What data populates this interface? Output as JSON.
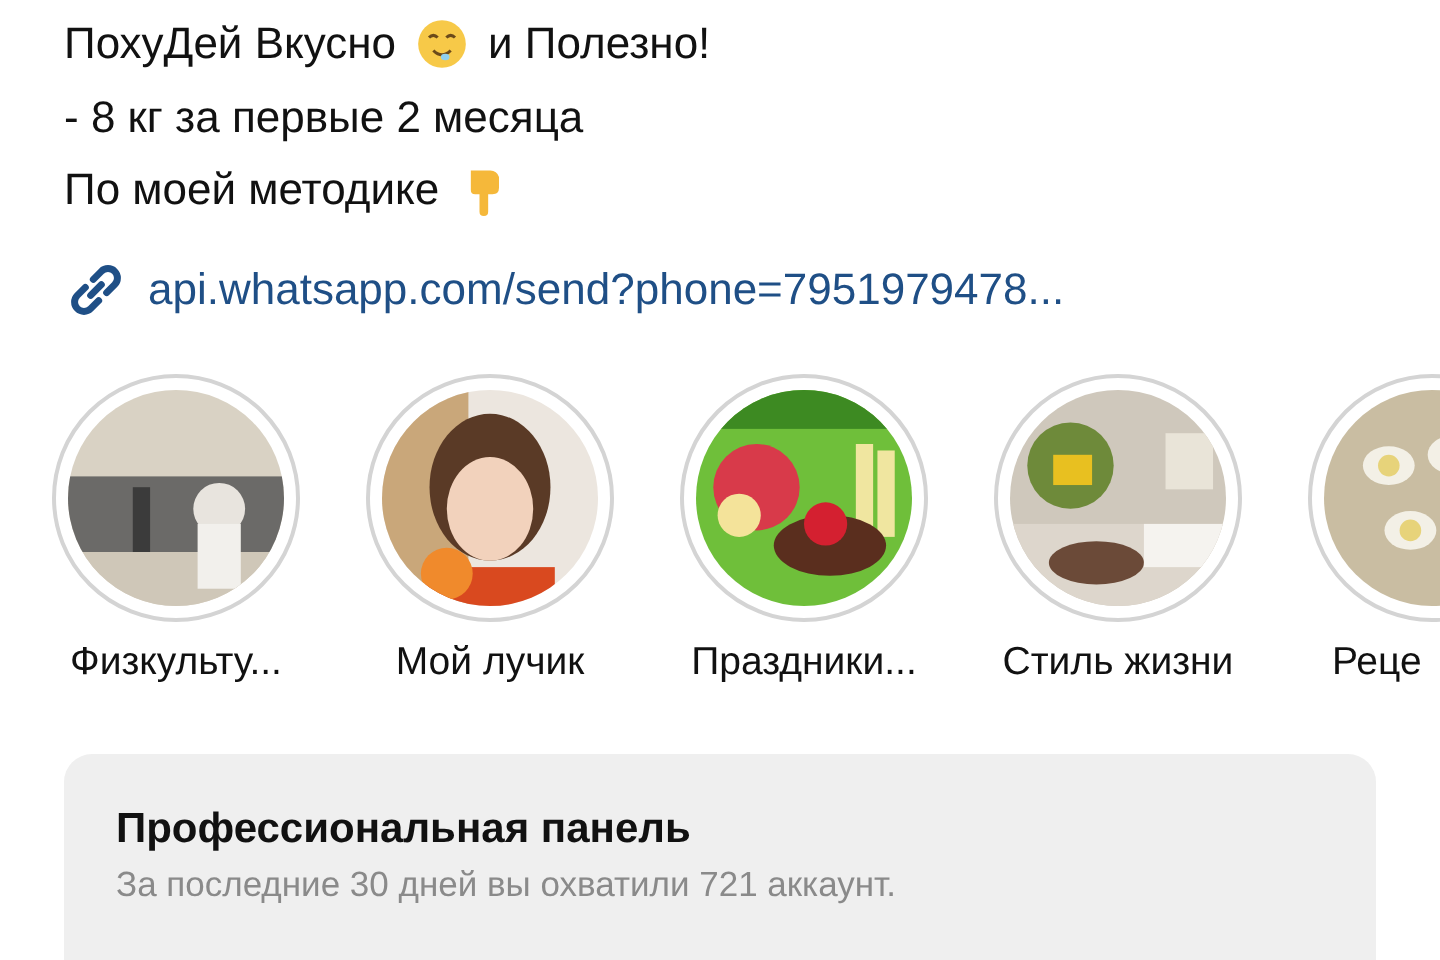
{
  "bio": {
    "lines": [
      {
        "text": "ПохуДей Вкусно",
        "kind": "face",
        "after": "и Полезно!"
      },
      {
        "text": "- 8 кг за первые 2 месяца"
      },
      {
        "text": "По моей методике",
        "kind": "pointing-down"
      }
    ],
    "link": "api.whatsapp.com/send?phone=7951979478..."
  },
  "highlights": [
    {
      "label": "Физкульту..."
    },
    {
      "label": "Мой лучик"
    },
    {
      "label": "Праздники..."
    },
    {
      "label": "Стиль жизни"
    },
    {
      "label": "Реце"
    }
  ],
  "panel": {
    "title": "Профессиональная панель",
    "subtitle": "За последние 30 дней вы охватили 721 аккаунт."
  }
}
